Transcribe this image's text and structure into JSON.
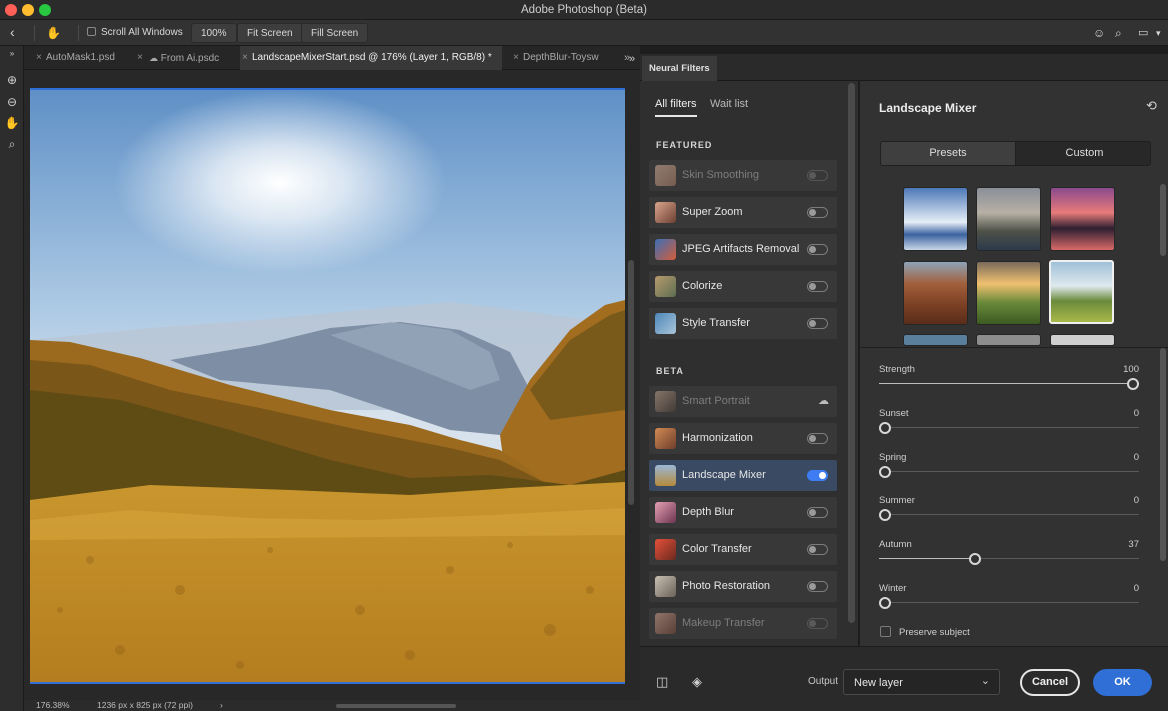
{
  "app": {
    "title": "Adobe Photoshop (Beta)"
  },
  "options_bar": {
    "scroll_all_windows": "Scroll All Windows",
    "zoom_100": "100%",
    "fit_screen": "Fit Screen",
    "fill_screen": "Fill Screen"
  },
  "doc_tabs": [
    {
      "label": "AutoMask1.psd"
    },
    {
      "label": "From Ai.psdc"
    },
    {
      "label": "LandscapeMixerStart.psd @ 176% (Layer 1, RGB/8) *"
    },
    {
      "label": "DepthBlur-Toysw"
    }
  ],
  "status_bar": {
    "zoom": "176.38%",
    "dimensions": "1236 px x 825 px (72 ppi)",
    "arrow": "›"
  },
  "neural_filters": {
    "panel_tab": "Neural Filters",
    "tabs": {
      "all": "All filters",
      "wait": "Wait list"
    },
    "featured_header": "FEATURED",
    "beta_header": "BETA",
    "featured": [
      {
        "label": "Skin Smoothing",
        "state": "dim"
      },
      {
        "label": "Super Zoom",
        "state": "off"
      },
      {
        "label": "JPEG Artifacts Removal",
        "state": "off"
      },
      {
        "label": "Colorize",
        "state": "off"
      },
      {
        "label": "Style Transfer",
        "state": "off"
      }
    ],
    "beta": [
      {
        "label": "Smart Portrait",
        "state": "cloud"
      },
      {
        "label": "Harmonization",
        "state": "off"
      },
      {
        "label": "Landscape Mixer",
        "state": "on"
      },
      {
        "label": "Depth Blur",
        "state": "off"
      },
      {
        "label": "Color Transfer",
        "state": "off"
      },
      {
        "label": "Photo Restoration",
        "state": "off"
      },
      {
        "label": "Makeup Transfer",
        "state": "dim"
      }
    ]
  },
  "landscape_mixer": {
    "title": "Landscape Mixer",
    "segment": {
      "presets": "Presets",
      "custom": "Custom"
    },
    "sliders": [
      {
        "name": "Strength",
        "value": 100
      },
      {
        "name": "Sunset",
        "value": 0
      },
      {
        "name": "Spring",
        "value": 0
      },
      {
        "name": "Summer",
        "value": 0
      },
      {
        "name": "Autumn",
        "value": 37
      },
      {
        "name": "Winter",
        "value": 0
      }
    ],
    "preserve_subject": "Preserve subject"
  },
  "footer": {
    "output_label": "Output",
    "output_value": "New layer",
    "cancel": "Cancel",
    "ok": "OK"
  },
  "colors": {
    "accent": "#2f6fd6",
    "toggle_on": "#3d7cf2",
    "panel_bg": "#323232"
  }
}
